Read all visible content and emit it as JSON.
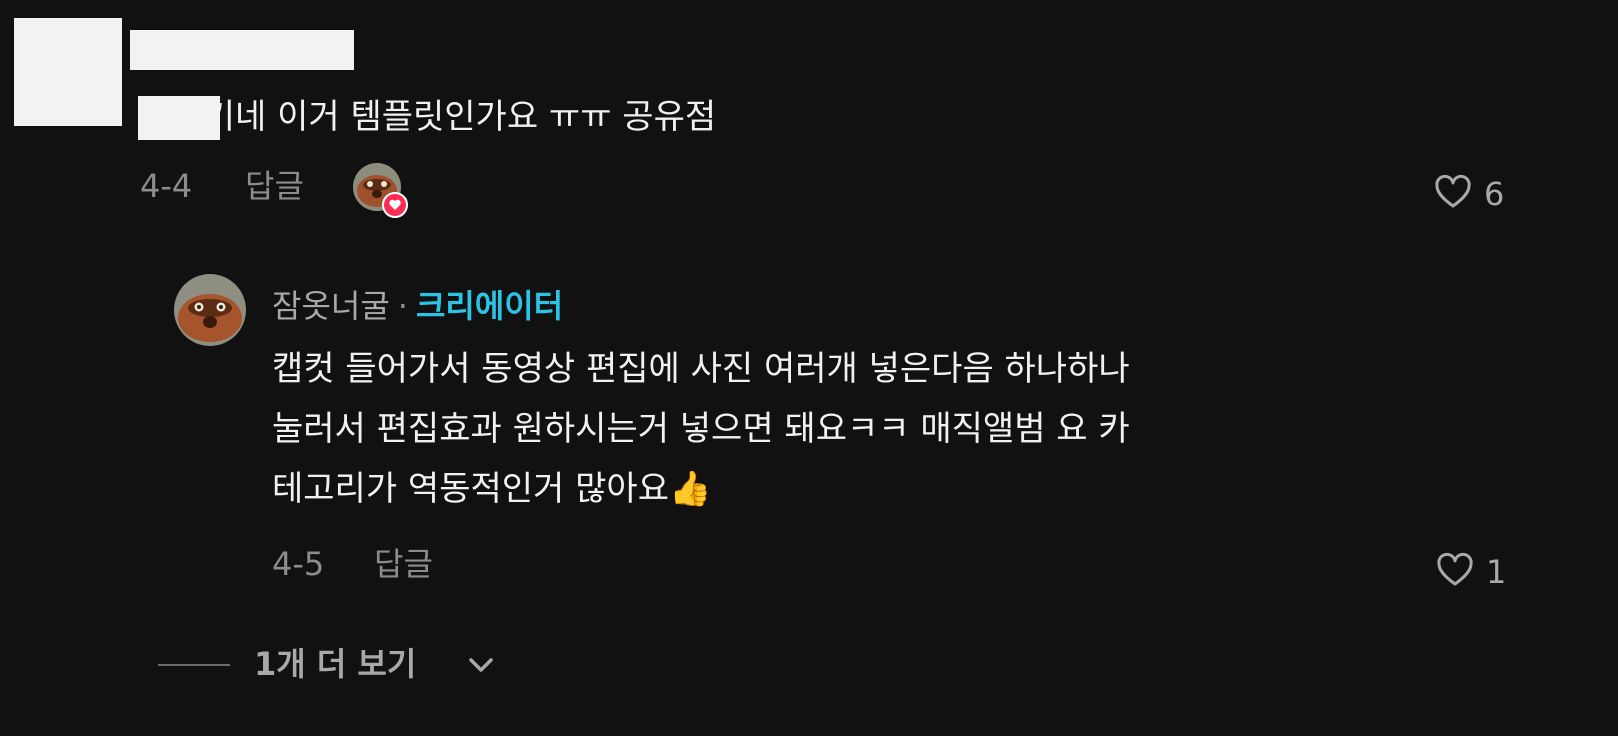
{
  "comment": {
    "text": "...웃기네 이거 템플릿인가요 ㅠㅠ 공유점",
    "date": "4-4",
    "reply_label": "답글",
    "likes": "6"
  },
  "reply": {
    "username": "잠옷너굴",
    "separator": "·",
    "badge": "크리에이터",
    "lines": [
      "캡컷 들어가서 동영상 편집에 사진 여러개 넣은다음 하나하나",
      "눌러서 편집효과 원하시는거 넣으면 돼요ㅋㅋ 매직앨범 요 카",
      "테고리가 역동적인거 많아요👍"
    ],
    "date": "4-5",
    "reply_label": "답글",
    "likes": "1"
  },
  "view_more": {
    "label": "1개 더 보기"
  },
  "icons": {
    "like": "heart-outline-icon",
    "creator_liked": "heart-badge-icon",
    "expand": "chevron-down-icon"
  },
  "colors": {
    "background": "#111111",
    "creator_badge": "#29c4e6",
    "liked_badge": "#fe2c55"
  }
}
